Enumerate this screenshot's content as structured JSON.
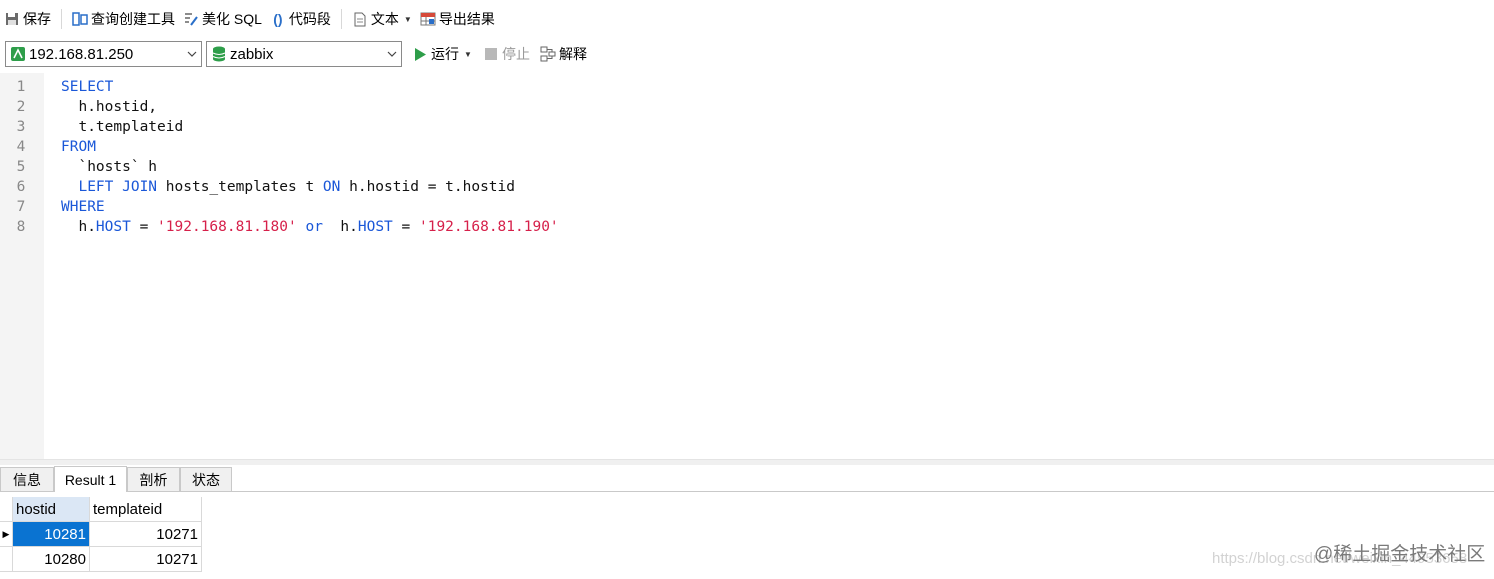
{
  "toolbar": {
    "save": "保存",
    "query_builder": "查询创建工具",
    "beautify": "美化 SQL",
    "snippet": "代码段",
    "text": "文本",
    "export": "导出结果"
  },
  "run_bar": {
    "connection": "192.168.81.250",
    "database": "zabbix",
    "run": "运行",
    "stop": "停止",
    "explain": "解释"
  },
  "editor": {
    "lines": [
      {
        "num": "1",
        "tokens": [
          {
            "t": "SELECT",
            "c": "kw"
          }
        ]
      },
      {
        "num": "2",
        "tokens": [
          {
            "t": "  h.hostid,",
            "c": ""
          }
        ]
      },
      {
        "num": "3",
        "tokens": [
          {
            "t": "  t.templateid",
            "c": ""
          }
        ]
      },
      {
        "num": "4",
        "tokens": [
          {
            "t": "FROM",
            "c": "kw"
          }
        ]
      },
      {
        "num": "5",
        "tokens": [
          {
            "t": "  `hosts` h",
            "c": ""
          }
        ]
      },
      {
        "num": "6",
        "tokens": [
          {
            "t": "  ",
            "c": ""
          },
          {
            "t": "LEFT JOIN",
            "c": "kw"
          },
          {
            "t": " hosts_templates t ",
            "c": ""
          },
          {
            "t": "ON",
            "c": "kw"
          },
          {
            "t": " h.hostid = t.hostid",
            "c": ""
          }
        ]
      },
      {
        "num": "7",
        "tokens": [
          {
            "t": "WHERE",
            "c": "kw"
          }
        ]
      },
      {
        "num": "8",
        "tokens": [
          {
            "t": "  h.",
            "c": ""
          },
          {
            "t": "HOST",
            "c": "kw"
          },
          {
            "t": " = ",
            "c": ""
          },
          {
            "t": "'192.168.81.180'",
            "c": "str"
          },
          {
            "t": " ",
            "c": ""
          },
          {
            "t": "or",
            "c": "kw"
          },
          {
            "t": "  h.",
            "c": ""
          },
          {
            "t": "HOST",
            "c": "kw"
          },
          {
            "t": " = ",
            "c": ""
          },
          {
            "t": "'192.168.81.190'",
            "c": "str"
          }
        ]
      }
    ]
  },
  "tabs": {
    "info": "信息",
    "result1": "Result 1",
    "profile": "剖析",
    "status": "状态"
  },
  "result": {
    "columns": [
      "hostid",
      "templateid"
    ],
    "rows": [
      [
        "10281",
        "10271"
      ],
      [
        "10280",
        "10271"
      ]
    ]
  },
  "watermark": "https://blog.csdn.net/weixin_44953658",
  "brand": "@稀土掘金技术社区"
}
